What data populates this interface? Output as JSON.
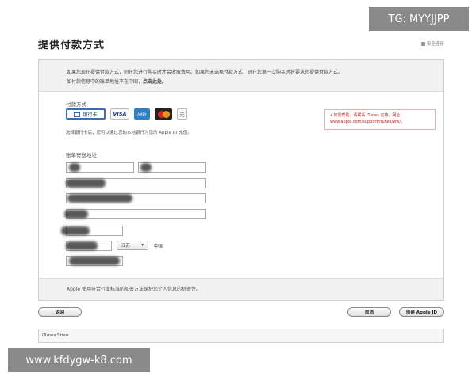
{
  "header": {
    "title": "提供付款方式",
    "secure_label": "安全连接"
  },
  "intro": {
    "line1": "如果您现在提供付款方式，则在您进行购买时才会收取费用。如果您未选择付款方式，则在您第一次购买时将要求您提供付款方式。",
    "line2_prefix": "如付款信息中的账单地址不在中国，",
    "line2_link": "点击此处。"
  },
  "payment": {
    "section_label": "付款方式",
    "options": {
      "bank": "银行卡",
      "visa": "VISA",
      "amex": "AMEX",
      "none": "无"
    },
    "note": "选择银行卡后，您可以通过您的本地银行为您的 Apple ID 充值。",
    "help_line1": "• 如需帮助，请联系 iTunes 支持，网址：",
    "help_line2": "www.apple.com/support/itunes/ww/。"
  },
  "address": {
    "section_label": "账单寄送地址",
    "province_value": "江苏",
    "country": "中国"
  },
  "footer": {
    "privacy_note": "Apple 使用符合行业标准的加密方法保护您个人信息的机密性。"
  },
  "buttons": {
    "back": "返回",
    "cancel": "取消",
    "create": "创建 Apple ID"
  },
  "store_bar": {
    "label": "iTunes Store"
  },
  "watermarks": {
    "tg": "TG: MYYJJPP",
    "url": "www.kfdygw-k8.com"
  }
}
